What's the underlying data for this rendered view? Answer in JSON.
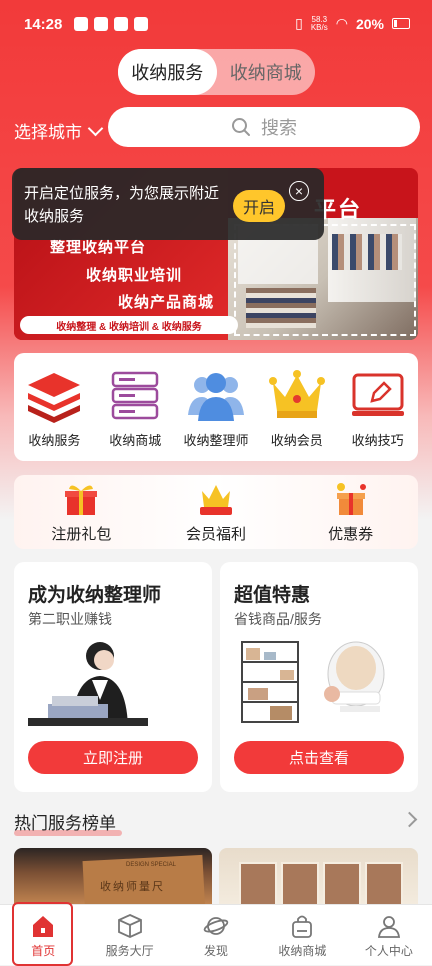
{
  "status": {
    "time": "14:28",
    "speed_num": "58.3",
    "speed_unit": "KB/s",
    "battery": "20%"
  },
  "segment": {
    "tabs": [
      {
        "label": "收纳服务",
        "active": true
      },
      {
        "label": "收纳商城",
        "active": false
      }
    ]
  },
  "city": {
    "label": "选择城市"
  },
  "search": {
    "placeholder": "搜索"
  },
  "banner": {
    "title": "平台",
    "line1": "整理收纳平台",
    "line2": "收纳职业培训",
    "line3": "收纳产品商城",
    "strip": "收纳整理 & 收纳培训 & 收纳服务"
  },
  "tip": {
    "text": "开启定位服务，为您展示附近收纳服务",
    "button": "开启"
  },
  "categories": [
    {
      "label": "收纳服务",
      "icon": "layers-icon"
    },
    {
      "label": "收纳商城",
      "icon": "server-icon"
    },
    {
      "label": "收纳整理师",
      "icon": "users-icon"
    },
    {
      "label": "收纳会员",
      "icon": "crown-icon"
    },
    {
      "label": "收纳技巧",
      "icon": "edit-monitor-icon"
    }
  ],
  "gifts": [
    {
      "label": "注册礼包",
      "icon": "gift-box-icon"
    },
    {
      "label": "会员福利",
      "icon": "crown-gift-icon"
    },
    {
      "label": "优惠券",
      "icon": "coupon-gift-icon"
    }
  ],
  "cards": {
    "left": {
      "title": "成为收纳整理师",
      "subtitle": "第二职业赚钱",
      "button": "立即注册"
    },
    "right": {
      "title": "超值特惠",
      "subtitle": "省钱商品/服务",
      "button": "点击查看"
    }
  },
  "hot": {
    "title": "热门服务榜单"
  },
  "thumbs": {
    "a_text": "收纳师量尺",
    "a_small": "DESIGN SPECIAL"
  },
  "nav": [
    {
      "label": "首页",
      "icon": "home-icon",
      "active": true
    },
    {
      "label": "服务大厅",
      "icon": "box-icon",
      "active": false
    },
    {
      "label": "发现",
      "icon": "planet-icon",
      "active": false
    },
    {
      "label": "收纳商城",
      "icon": "bag-icon",
      "active": false
    },
    {
      "label": "个人中心",
      "icon": "person-icon",
      "active": false
    }
  ],
  "colors": {
    "accent": "#f23a3a",
    "tip_button": "#ffc62b",
    "nav_active": "#e03333"
  }
}
